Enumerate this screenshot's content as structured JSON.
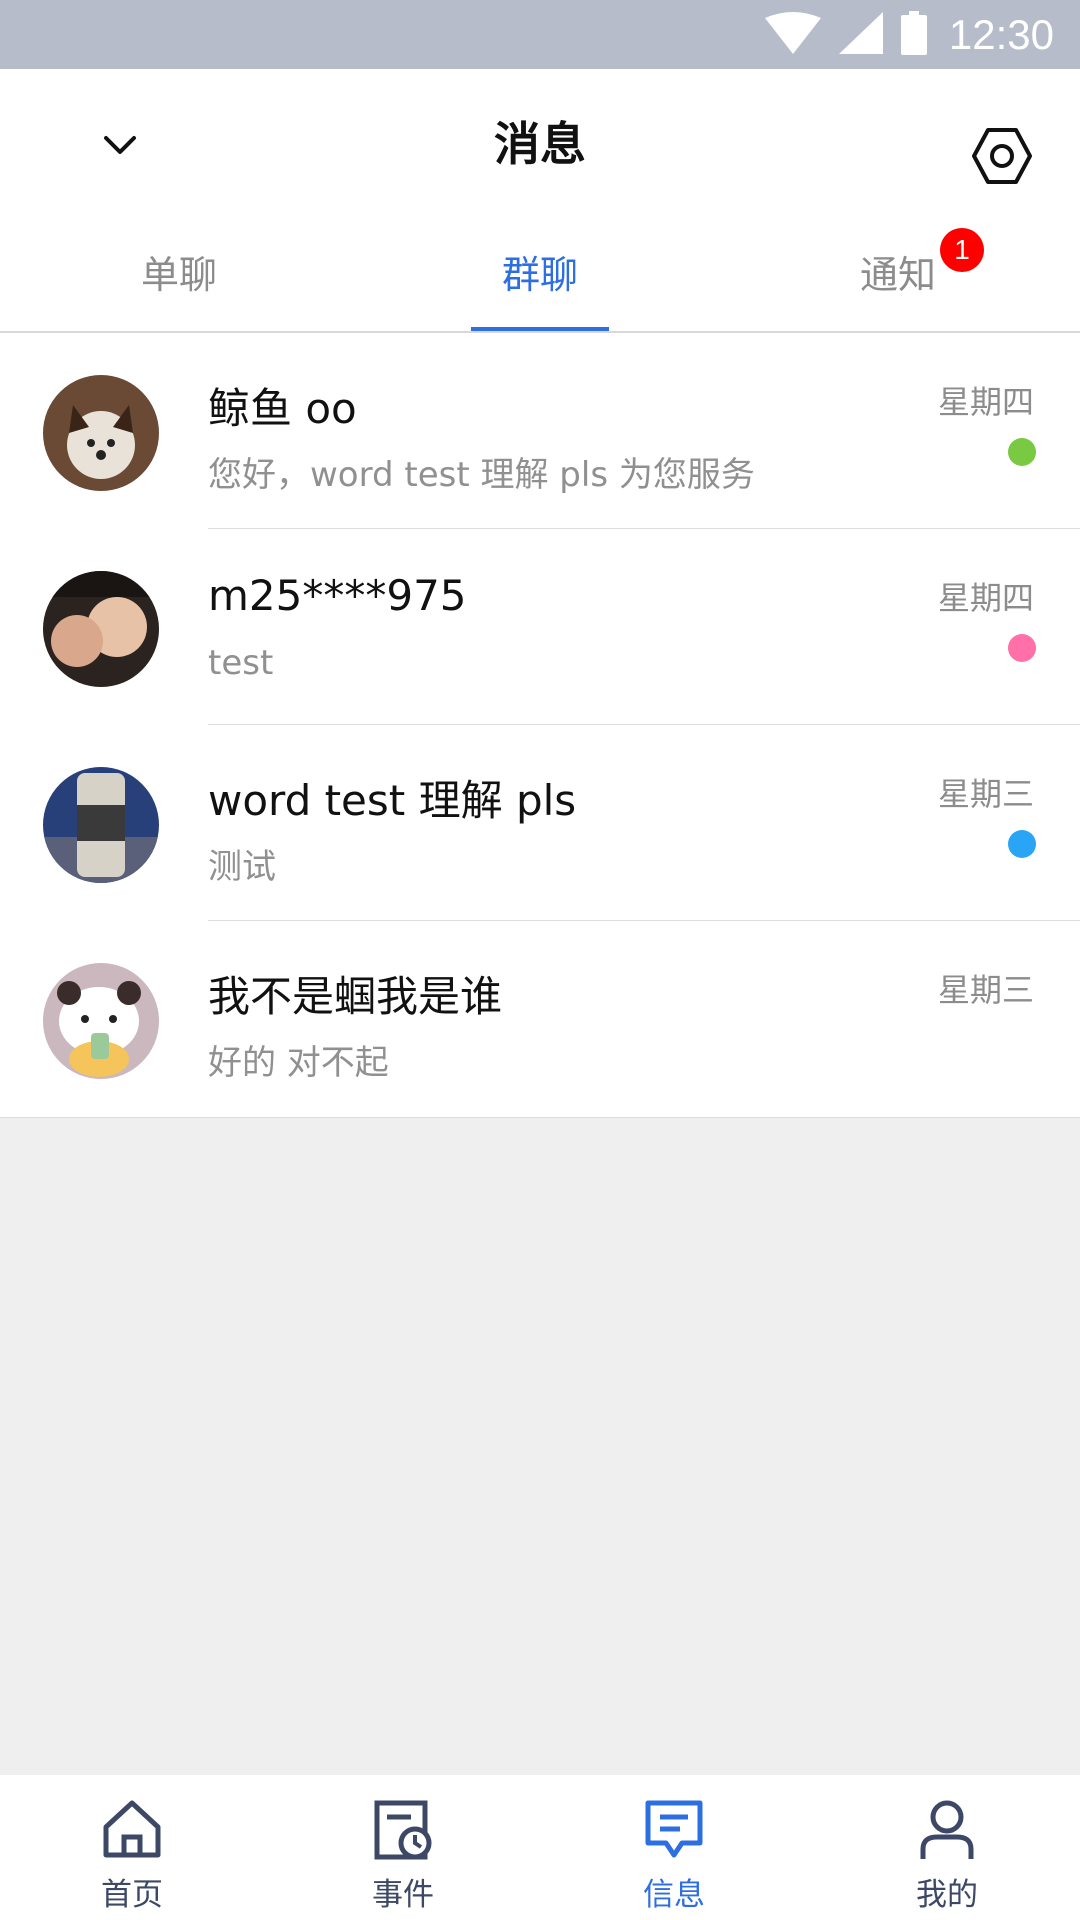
{
  "status_bar": {
    "time": "12:30"
  },
  "header": {
    "title": "消息"
  },
  "tabs": [
    {
      "label": "单聊",
      "active": false
    },
    {
      "label": "群聊",
      "active": true
    },
    {
      "label": "通知",
      "active": false,
      "badge": "1"
    }
  ],
  "conversations": [
    {
      "name": "鲸鱼 oo",
      "preview": "您好，word test 理解 pls 为您服务",
      "day": "星期四",
      "dot_color": "#7ac943"
    },
    {
      "name": "m25****975",
      "preview": "test",
      "day": "星期四",
      "dot_color": "#ff6fa8"
    },
    {
      "name": "word test 理解 pls",
      "preview": "测试",
      "day": "星期三",
      "dot_color": "#2aa5f5"
    },
    {
      "name": "我不是蝈我是谁",
      "preview": "好的 对不起",
      "day": "星期三",
      "dot_color": null
    }
  ],
  "bottom_nav": [
    {
      "label": "首页",
      "icon": "home-icon",
      "active": false
    },
    {
      "label": "事件",
      "icon": "calendar-clock-icon",
      "active": false
    },
    {
      "label": "信息",
      "icon": "message-icon",
      "active": true
    },
    {
      "label": "我的",
      "icon": "user-icon",
      "active": false
    }
  ],
  "colors": {
    "accent": "#2d6fe0",
    "badge": "#ff0000",
    "status_bar": "#b6bcc9"
  }
}
